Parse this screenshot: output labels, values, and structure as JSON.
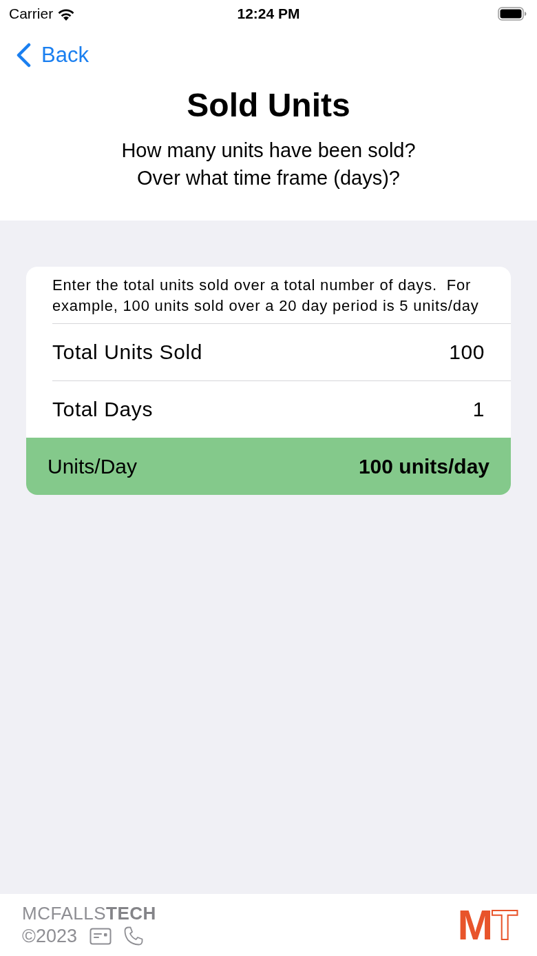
{
  "status_bar": {
    "carrier": "Carrier",
    "time": "12:24 PM"
  },
  "nav": {
    "back": "Back"
  },
  "header": {
    "title": "Sold Units",
    "subtitle": "How many units have been sold?\nOver what time frame (days)?"
  },
  "form": {
    "instructions": "Enter the total units sold over a total number of days.  For example, 100 units sold over a 20 day period is 5 units/day",
    "fields": [
      {
        "label": "Total Units Sold",
        "value": "100"
      },
      {
        "label": "Total Days",
        "value": "1"
      }
    ],
    "result": {
      "label": "Units/Day",
      "value": "100 units/day"
    }
  },
  "footer": {
    "brand": "MCFALLS**TECH**",
    "copyright": "©2023",
    "logo": [
      {
        "text": "M",
        "kind": "solid"
      },
      {
        "text": "T",
        "kind": "outline"
      }
    ]
  }
}
